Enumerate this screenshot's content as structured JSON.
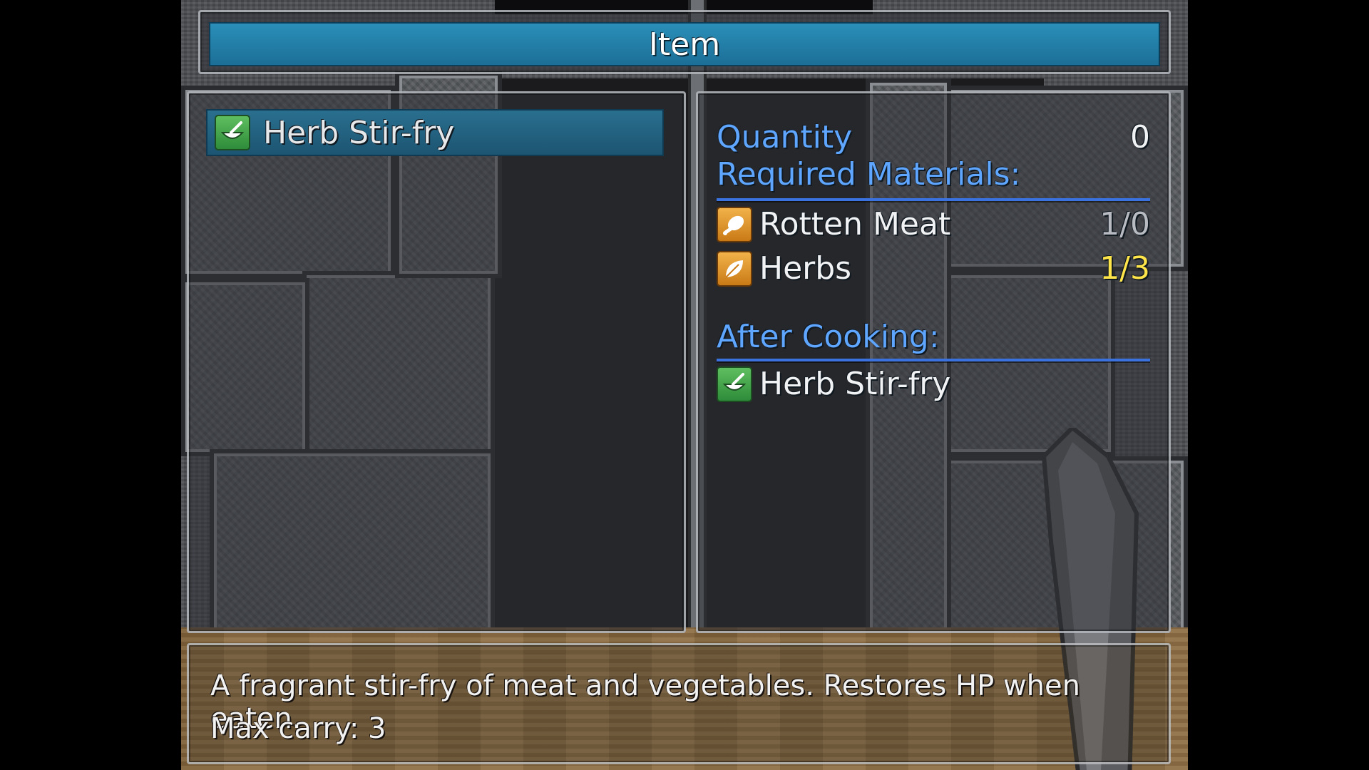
{
  "title": "Item",
  "list": {
    "items": [
      {
        "label": "Herb Stir-fry",
        "icon": "bowl-icon"
      }
    ]
  },
  "detail": {
    "quantity_label": "Quantity",
    "quantity_value": "0",
    "required_label": "Required Materials:",
    "materials": [
      {
        "name": "Rotten Meat",
        "count": "1/0",
        "icon": "meat-icon"
      },
      {
        "name": "Herbs",
        "count": "1/3",
        "icon": "leaf-icon"
      }
    ],
    "after_label": "After Cooking:",
    "result": {
      "name": "Herb Stir-fry",
      "icon": "bowl-icon"
    }
  },
  "help": {
    "line1": "A fragrant stir-fry of meat and vegetables. Restores HP when eaten.",
    "line2": "Max carry: 3"
  },
  "colors": {
    "header_blue": "#1c6f97",
    "label_blue": "#5ea6ff",
    "highlight_yellow": "#ffe54a"
  }
}
